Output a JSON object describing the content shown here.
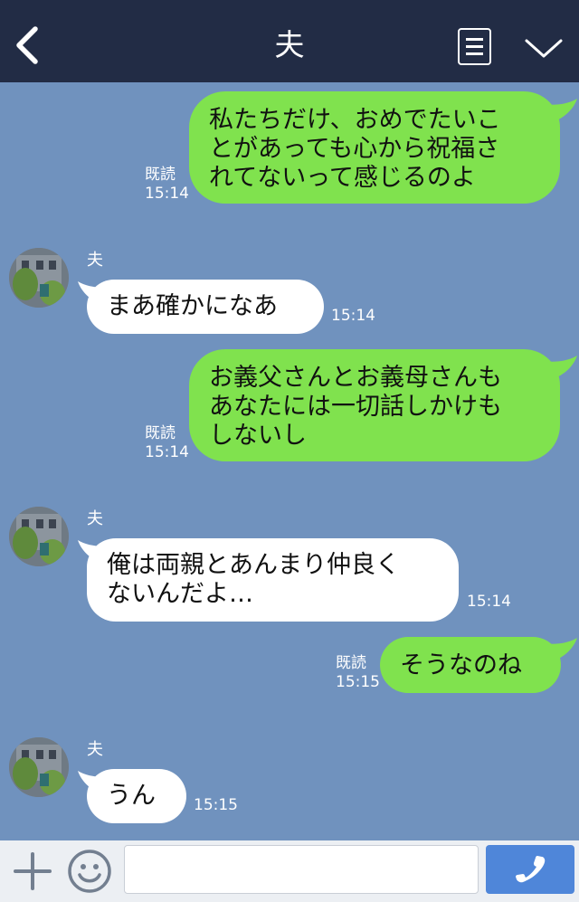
{
  "header": {
    "title": "夫",
    "back_icon": "chevron-left-icon",
    "menu_icon": "menu-icon",
    "expand_icon": "chevron-down-icon",
    "background": "#222c45"
  },
  "colors": {
    "chat_background": "#7092be",
    "outgoing_bubble": "#80e24e",
    "incoming_bubble": "#ffffff",
    "send_button": "#4f86d9"
  },
  "messages": [
    {
      "direction": "out",
      "text": "私たちだけ、おめでたいこ\nとがあっても心から祝福さ\nれてないって感じるのよ",
      "read": "既読",
      "time": "15:14"
    },
    {
      "direction": "in",
      "sender": "夫",
      "text": "まあ確かになあ",
      "time": "15:14"
    },
    {
      "direction": "out",
      "text": "お義父さんとお義母さんも\nあなたには一切話しかけも\nしないし",
      "read": "既読",
      "time": "15:14"
    },
    {
      "direction": "in",
      "sender": "夫",
      "text": "俺は両親とあんまり仲良く\nないんだよ…",
      "time": "15:14"
    },
    {
      "direction": "out",
      "text": "そうなのね",
      "read": "既読",
      "time": "15:15"
    },
    {
      "direction": "in",
      "sender": "夫",
      "text": "うん",
      "time": "15:15"
    }
  ],
  "input_bar": {
    "plus_icon": "plus-icon",
    "emoji_icon": "smiley-icon",
    "message_value": "",
    "call_icon": "phone-icon"
  }
}
